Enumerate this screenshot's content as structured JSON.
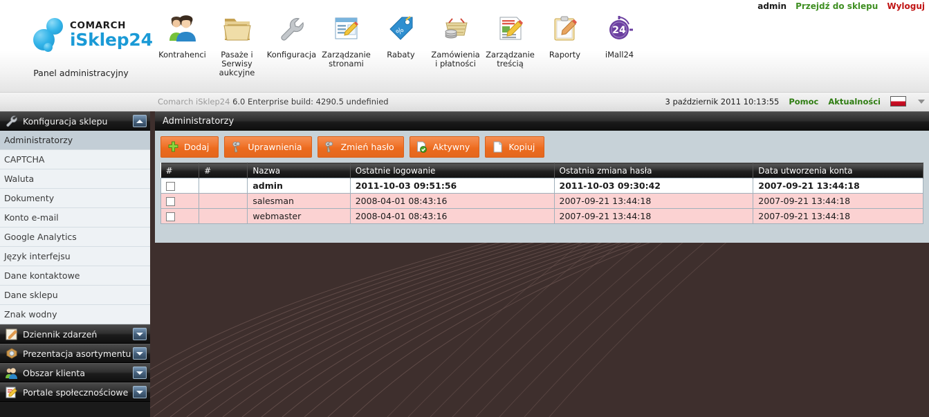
{
  "userbar": {
    "username": "admin",
    "goto_shop": "Przejdź do sklepu",
    "logout": "Wyloguj"
  },
  "logo": {
    "brand": "COMARCH",
    "product": "iSklep24",
    "subtitle": "Panel administracyjny"
  },
  "nav": [
    {
      "label": "Kontrahenci",
      "icon": "users-icon"
    },
    {
      "label": "Pasaże i Serwisy aukcyjne",
      "icon": "folders-icon"
    },
    {
      "label": "Konfiguracja",
      "icon": "wrench-icon"
    },
    {
      "label": "Zarządzanie stronami",
      "icon": "page-edit-icon"
    },
    {
      "label": "Rabaty",
      "icon": "discount-tag-icon"
    },
    {
      "label": "Zamówienia i płatności",
      "icon": "basket-coins-icon"
    },
    {
      "label": "Zarządzanie treścią",
      "icon": "document-edit-icon"
    },
    {
      "label": "Raporty",
      "icon": "clipboard-pencil-icon"
    },
    {
      "label": "iMall24",
      "icon": "imall24-badge-icon"
    }
  ],
  "statusbar": {
    "product": "Comarch iSklep24",
    "version": "6.0 Enterprise build: 4290.5",
    "undefined_text": "undefinied",
    "datetime": "3 październik 2011 10:13:55",
    "help": "Pomoc",
    "news": "Aktualności",
    "flag": "pl-flag-icon"
  },
  "sidebar": {
    "sections": [
      {
        "title": "Konfiguracja sklepu",
        "icon": "wrench-icon",
        "expanded": true,
        "toggle": "collapse",
        "items": [
          {
            "label": "Administratorzy",
            "selected": true
          },
          {
            "label": "CAPTCHA",
            "selected": false
          },
          {
            "label": "Waluta",
            "selected": false
          },
          {
            "label": "Dokumenty",
            "selected": false
          },
          {
            "label": "Konto e-mail",
            "selected": false
          },
          {
            "label": "Google Analytics",
            "selected": false
          },
          {
            "label": "Język interfejsu",
            "selected": false
          },
          {
            "label": "Dane kontaktowe",
            "selected": false
          },
          {
            "label": "Dane sklepu",
            "selected": false
          },
          {
            "label": "Znak wodny",
            "selected": false
          }
        ]
      },
      {
        "title": "Dziennik zdarzeń",
        "icon": "notepad-icon",
        "expanded": false,
        "toggle": "expand",
        "items": []
      },
      {
        "title": "Prezentacja asortymentu",
        "icon": "box-icon",
        "expanded": false,
        "toggle": "expand",
        "items": []
      },
      {
        "title": "Obszar klienta",
        "icon": "users-icon",
        "expanded": false,
        "toggle": "expand",
        "items": []
      },
      {
        "title": "Portale społecznościowe",
        "icon": "page-pencil-icon",
        "expanded": false,
        "toggle": "expand",
        "items": []
      }
    ]
  },
  "panel": {
    "title": "Administratorzy",
    "buttons": [
      {
        "label": "Dodaj",
        "icon": "plus-icon"
      },
      {
        "label": "Uprawnienia",
        "icon": "keys-icon"
      },
      {
        "label": "Zmień hasło",
        "icon": "keys-icon"
      },
      {
        "label": "Aktywny",
        "icon": "page-check-icon"
      },
      {
        "label": "Kopiuj",
        "icon": "copy-page-icon"
      }
    ],
    "table": {
      "headers": [
        "#",
        "#",
        "Nazwa",
        "Ostatnie logowanie",
        "Ostatnia zmiana hasła",
        "Data utworzenia konta"
      ],
      "rows": [
        {
          "highlight": "white",
          "checked": false,
          "name": "admin",
          "last_login": "2011-10-03 09:51:56",
          "last_password_change": "2011-10-03 09:30:42",
          "created": "2007-09-21 13:44:18"
        },
        {
          "highlight": "pink",
          "checked": false,
          "name": "salesman",
          "last_login": "2008-04-01 08:43:16",
          "last_password_change": "2007-09-21 13:44:18",
          "created": "2007-09-21 13:44:18"
        },
        {
          "highlight": "pink",
          "checked": false,
          "name": "webmaster",
          "last_login": "2008-04-01 08:43:16",
          "last_password_change": "2007-09-21 13:44:18",
          "created": "2007-09-21 13:44:18"
        }
      ]
    }
  },
  "colors": {
    "accent_orange": "#ec6b1f",
    "dark_background": "#3e2f2d",
    "panel_background": "#c7d2d8",
    "row_pink": "#fbd2d2",
    "link_green": "#2f7d12",
    "link_red": "#c01414",
    "brand_blue": "#1a9ad6"
  }
}
